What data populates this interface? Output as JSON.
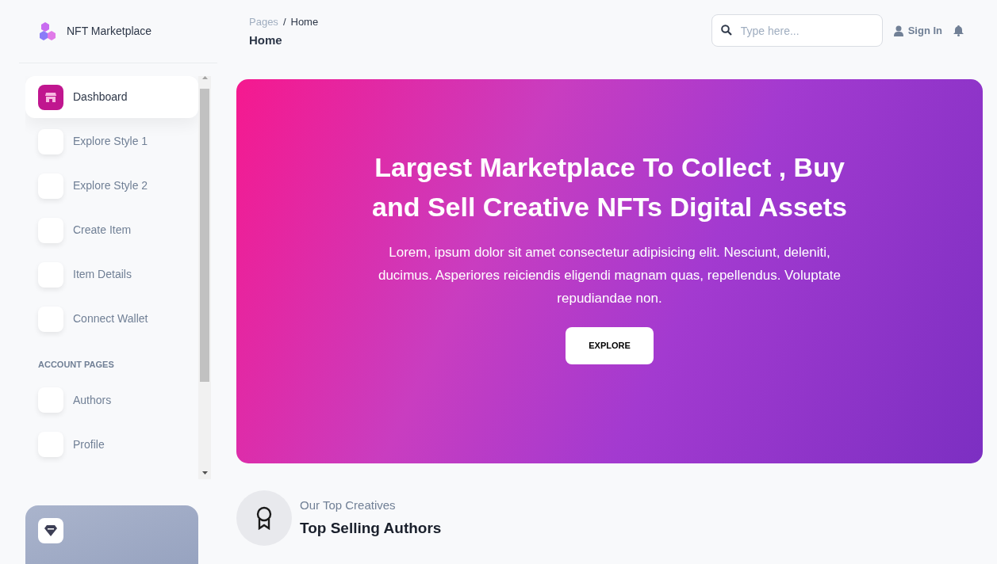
{
  "brand": {
    "name": "NFT Marketplace"
  },
  "nav": [
    {
      "label": "Dashboard",
      "selected": true
    },
    {
      "label": "Explore Style 1",
      "selected": false
    },
    {
      "label": "Explore Style 2",
      "selected": false
    },
    {
      "label": "Create Item",
      "selected": false
    },
    {
      "label": "Item Details",
      "selected": false
    },
    {
      "label": "Connect Wallet",
      "selected": false
    }
  ],
  "nav_section": "ACCOUNT PAGES",
  "account_nav": [
    {
      "label": "Authors",
      "selected": false
    },
    {
      "label": "Profile",
      "selected": false
    }
  ],
  "breadcrumb": {
    "parent": "Pages",
    "separator": "/",
    "current": "Home",
    "title": "Home"
  },
  "search": {
    "placeholder": "Type here..."
  },
  "sign_in": "Sign In",
  "hero": {
    "title": "Largest Marketplace To Collect , Buy and Sell Creative NFTs Digital Assets",
    "text": "Lorem, ipsum dolor sit amet consectetur adipisicing elit. Nesciunt, deleniti, ducimus. Asperiores reiciendis eligendi magnam quas, repellendus. Voluptate repudiandae non.",
    "button": "EXPLORE"
  },
  "section": {
    "eyebrow": "Our Top Creatives",
    "title": "Top Selling Authors"
  }
}
